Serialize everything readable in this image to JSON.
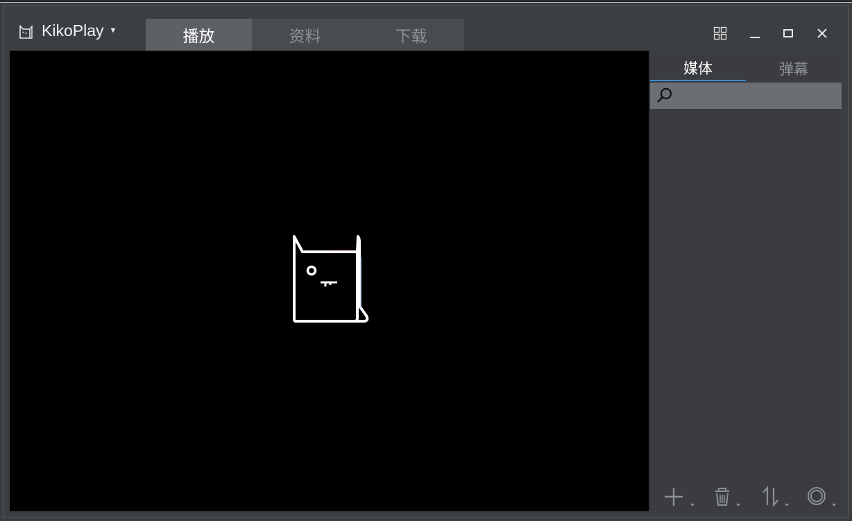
{
  "app": {
    "title": "KikoPlay"
  },
  "tabs": [
    {
      "label": "播放",
      "active": true
    },
    {
      "label": "资料",
      "active": false
    },
    {
      "label": "下载",
      "active": false
    }
  ],
  "side_tabs": [
    {
      "label": "媒体",
      "active": true
    },
    {
      "label": "弹幕",
      "active": false
    }
  ],
  "search": {
    "value": "",
    "placeholder": ""
  },
  "window_controls": [
    "grid-icon",
    "minimize-icon",
    "maximize-icon",
    "close-icon"
  ],
  "bottom_toolbar": [
    "add-icon",
    "delete-icon",
    "sort-icon",
    "settings-icon"
  ],
  "colors": {
    "accent": "#3a8fd4",
    "background": "#3c3f42",
    "player": "#000000"
  }
}
